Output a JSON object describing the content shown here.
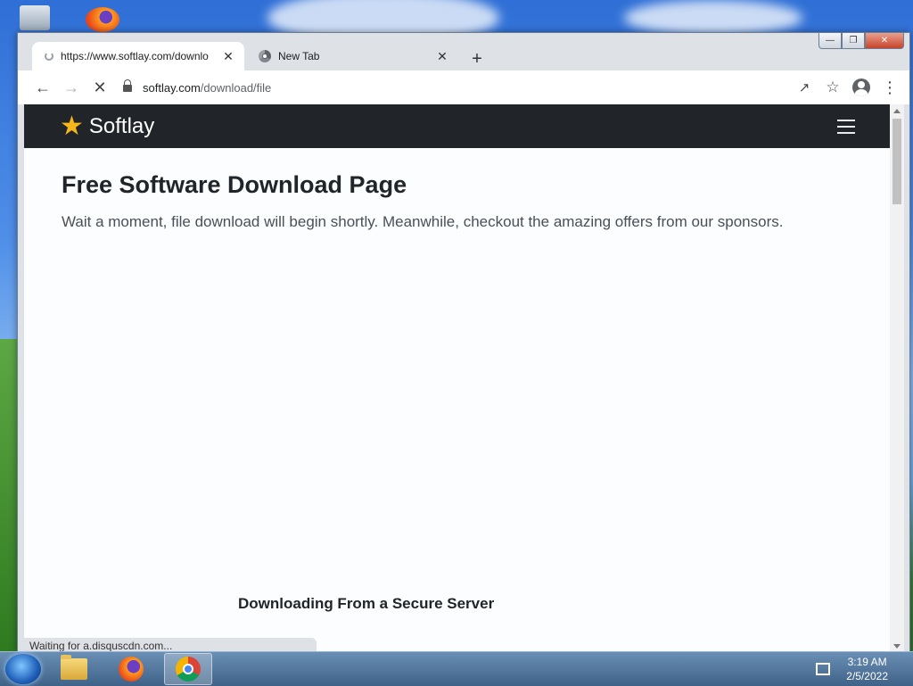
{
  "browser": {
    "tabs": [
      {
        "title": "https://www.softlay.com/downlo",
        "state": "loading"
      },
      {
        "title": "New Tab",
        "state": "idle"
      }
    ],
    "new_tab_label": "+",
    "address": {
      "domain": "softlay.com",
      "path": "/download/file"
    },
    "status_text": "Waiting for a.disquscdn.com..."
  },
  "site": {
    "brand": "Softlay",
    "heading": "Free Software Download Page",
    "message": "Wait a moment, file download will begin shortly. Meanwhile, checkout the amazing offers from our sponsors.",
    "secure_label": "Downloading From a Secure Server"
  },
  "taskbar": {
    "apps": [
      "file-explorer",
      "firefox",
      "chrome"
    ],
    "active_app": "chrome",
    "time": "3:19 AM",
    "date": "2/5/2022"
  },
  "colors": {
    "navbar_bg": "#212529",
    "brand_star": "#f5b719",
    "page_bg": "#fbfdff"
  }
}
